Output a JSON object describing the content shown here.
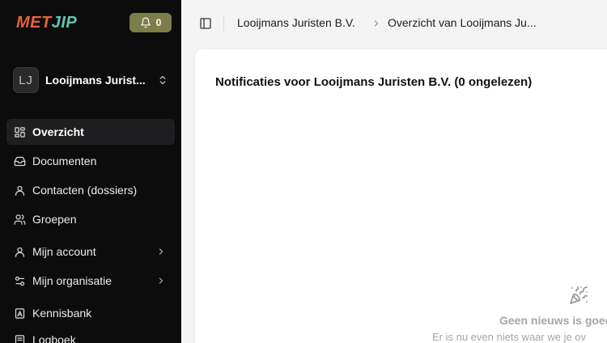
{
  "brand": {
    "logo_part1": "MET",
    "logo_part2": "JIP",
    "accent": "#e8603c",
    "accent2": "#5fc8b0"
  },
  "notifications": {
    "icon": "bell-icon",
    "count": "0"
  },
  "organization": {
    "initials": "LJ",
    "name": "Looijmans Jurist..."
  },
  "sidebar": {
    "items": [
      {
        "label": "Overzicht",
        "icon": "layout-grid-icon",
        "active": true
      },
      {
        "label": "Documenten",
        "icon": "inbox-icon"
      },
      {
        "label": "Contacten (dossiers)",
        "icon": "user-icon"
      },
      {
        "label": "Groepen",
        "icon": "users-icon"
      },
      {
        "label": "Mijn account",
        "icon": "user-icon",
        "has_submenu": true
      },
      {
        "label": "Mijn organisatie",
        "icon": "settings-sliders-icon",
        "has_submenu": true
      },
      {
        "label": "Kennisbank",
        "icon": "book-icon"
      },
      {
        "label": "Logboek",
        "icon": "list-icon"
      }
    ]
  },
  "header": {
    "breadcrumb": [
      "Looijmans Juristen B.V.",
      "Overzicht van Looijmans Ju..."
    ]
  },
  "main": {
    "title": "Notificaties voor Looijmans Juristen B.V. (0 ongelezen)",
    "empty_icon": "party-popper-icon",
    "empty_title": "Geen nieuws is goed",
    "empty_subtitle": "Er is nu even niets waar we je ov"
  }
}
